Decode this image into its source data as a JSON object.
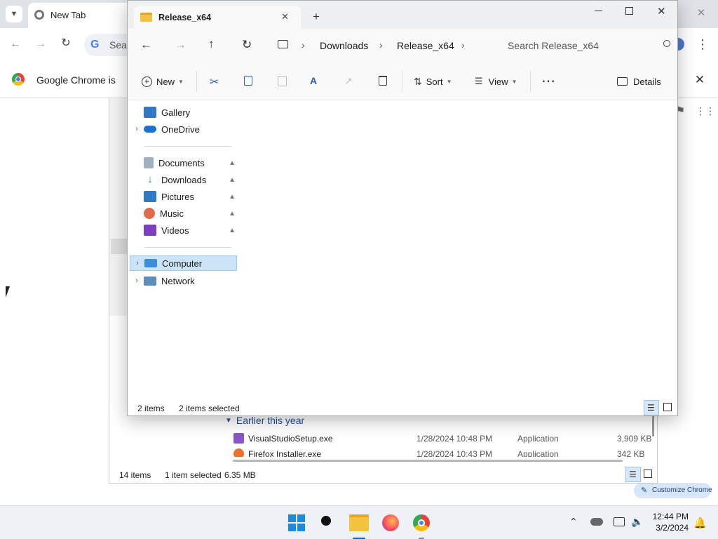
{
  "chrome": {
    "tab_title": "New Tab",
    "search_partial": "Sear",
    "infobar_text": "Google Chrome is",
    "customize_label": "Customize Chrome"
  },
  "bg_explorer": {
    "group_header": "Earlier this year",
    "files": [
      {
        "name": "VisualStudioSetup.exe",
        "date": "1/28/2024 10:48 PM",
        "type": "Application",
        "size": "3,909 KB"
      },
      {
        "name": "Firefox Installer.exe",
        "date": "1/28/2024 10:43 PM",
        "type": "Application",
        "size": "342 KB"
      }
    ],
    "status": {
      "count": "14 items",
      "selected": "1 item selected",
      "size": "6.35 MB"
    }
  },
  "fg_explorer": {
    "tab_title": "Release_x64",
    "breadcrumb": [
      "Downloads",
      "Release_x64"
    ],
    "search_placeholder": "Search Release_x64",
    "commands": {
      "new": "New",
      "sort": "Sort",
      "view": "View",
      "details": "Details"
    },
    "nav": {
      "gallery": "Gallery",
      "onedrive": "OneDrive",
      "documents": "Documents",
      "downloads": "Downloads",
      "pictures": "Pictures",
      "music": "Music",
      "videos": "Videos",
      "computer": "Computer",
      "network": "Network"
    },
    "status": {
      "count": "2 items",
      "selected": "2 items selected"
    }
  },
  "taskbar": {
    "time": "12:44 PM",
    "date": "3/2/2024"
  },
  "colors": {
    "selection": "#cce4f7",
    "accent": "#0067c0",
    "taskbar": "#eef2f7"
  }
}
